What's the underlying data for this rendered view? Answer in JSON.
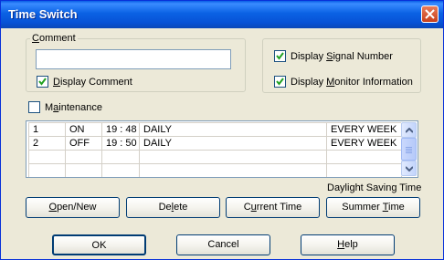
{
  "window": {
    "title": "Time Switch"
  },
  "comment_group": {
    "legend": "Comment",
    "value": "",
    "display_comment_label": "Display Comment",
    "display_comment_checked": true
  },
  "display_group": {
    "signal_number_label": "Display Signal Number",
    "signal_number_checked": true,
    "monitor_info_label": "Display Monitor Information",
    "monitor_info_checked": true
  },
  "maintenance": {
    "label": "Maintenance",
    "checked": false
  },
  "schedule": {
    "rows": [
      {
        "no": "1",
        "state": "ON",
        "time": "19 : 48",
        "pattern": "DAILY",
        "repeat": "EVERY WEEK"
      },
      {
        "no": "2",
        "state": "OFF",
        "time": "19 : 50",
        "pattern": "DAILY",
        "repeat": "EVERY WEEK"
      }
    ],
    "empty_rows": 2
  },
  "daylight_label": "Daylight Saving Time",
  "action_buttons": {
    "open_new": "Open/New",
    "delete": "Delete",
    "current_time": "Current Time",
    "summer_time": "Summer Time"
  },
  "dialog_buttons": {
    "ok": "OK",
    "cancel": "Cancel",
    "help": "Help"
  },
  "colors": {
    "titlebar": "#0b62e4",
    "dialog_bg": "#ece9d8",
    "close_button": "#c8401b"
  }
}
